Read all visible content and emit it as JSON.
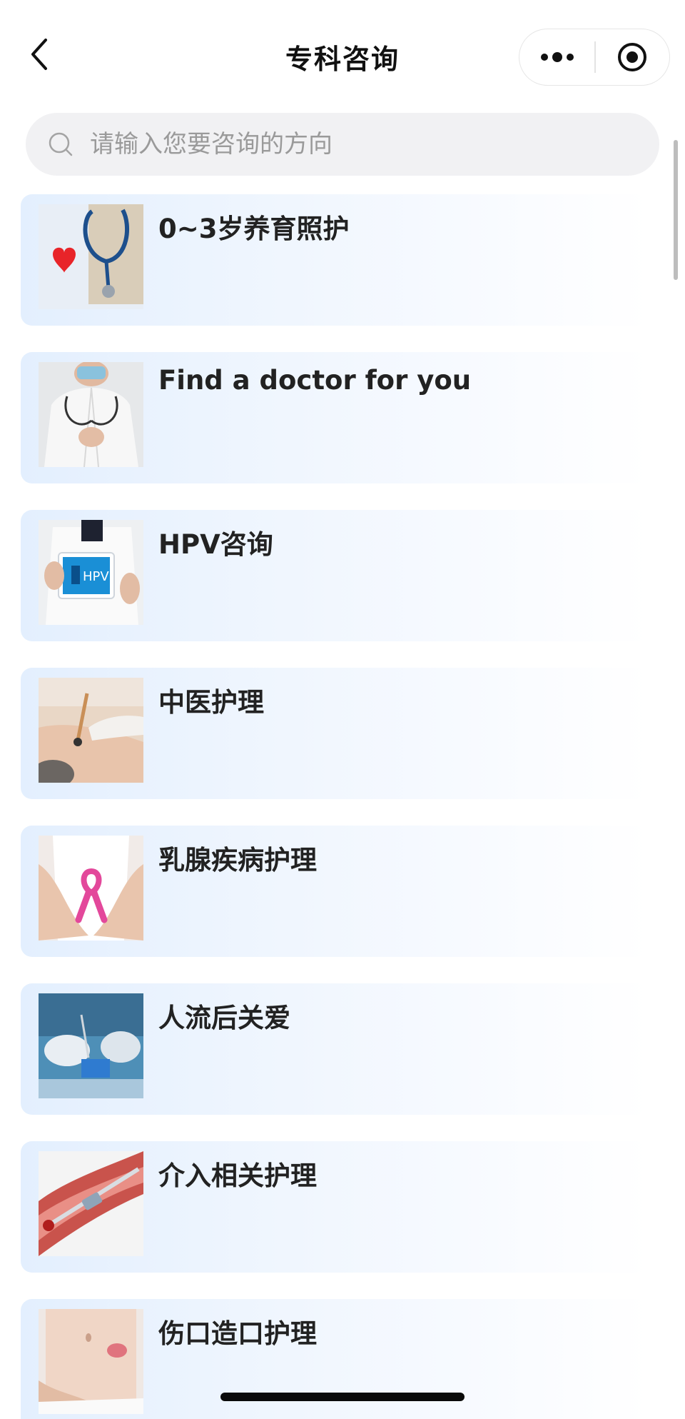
{
  "navbar": {
    "title": "专科咨询",
    "back_icon": "chevron-left-icon",
    "more_icon": "more-dots-icon",
    "close_icon": "target-circle-icon"
  },
  "search": {
    "placeholder": "请输入您要咨询的方向",
    "value": ""
  },
  "list": {
    "items": [
      {
        "title": "0~3岁养育照护",
        "image": "stethoscope-heart-image"
      },
      {
        "title": "Find a doctor for you",
        "image": "doctor-portrait-image"
      },
      {
        "title": "HPV咨询",
        "image": "doctor-hpv-tablet-image"
      },
      {
        "title": "中医护理",
        "image": "tcm-treatment-image"
      },
      {
        "title": "乳腺疾病护理",
        "image": "pink-ribbon-image"
      },
      {
        "title": "人流后关爱",
        "image": "surgery-room-image"
      },
      {
        "title": "介入相关护理",
        "image": "blood-vessel-catheter-image"
      },
      {
        "title": "伤口造口护理",
        "image": "abdomen-wound-image"
      }
    ]
  },
  "colors": {
    "card_gradient_start": "#e3effe",
    "card_gradient_end": "#ffffff",
    "search_bg": "#f1f1f3",
    "title_text": "#222222"
  }
}
